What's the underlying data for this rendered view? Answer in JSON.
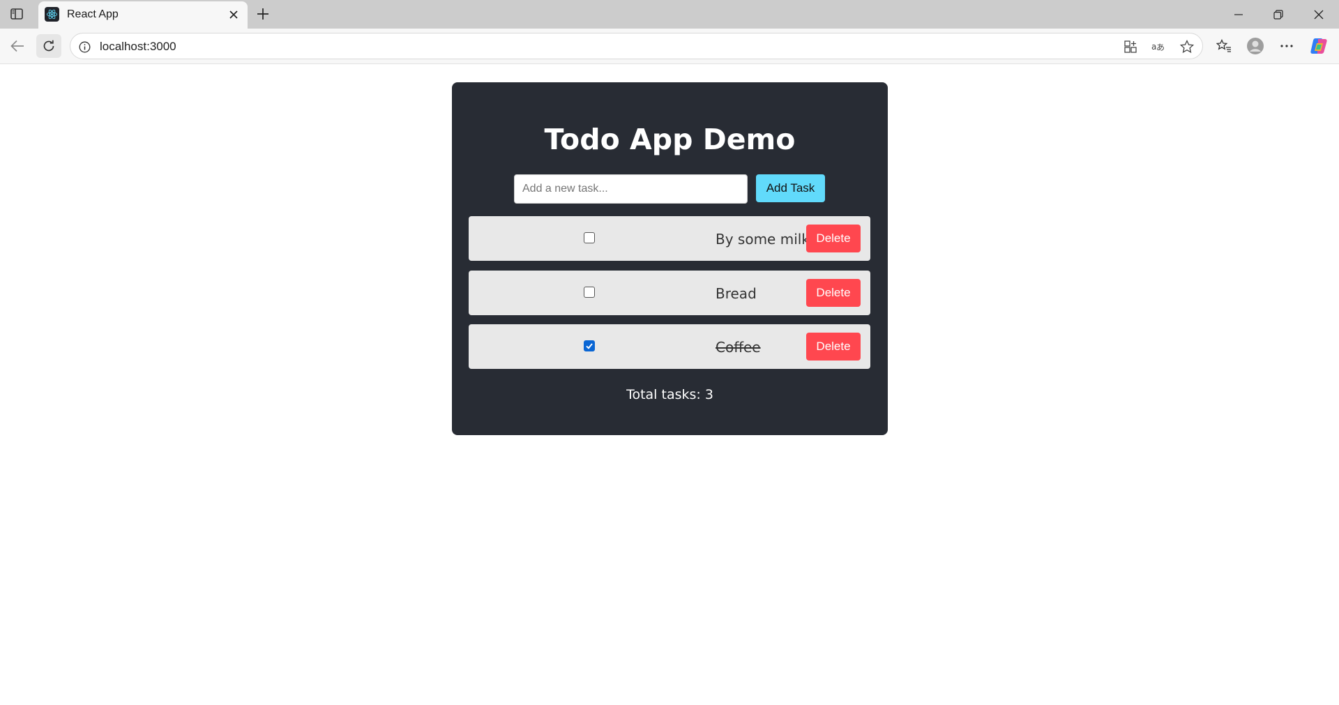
{
  "browser": {
    "tab_title": "React App",
    "url": "localhost:3000",
    "icons": {
      "sidebar": "sidebar-toggle-icon",
      "favicon": "react-logo-icon",
      "tab_close": "close-icon",
      "new_tab": "plus-icon",
      "back": "arrow-left-icon",
      "reload": "reload-icon",
      "site_info": "info-icon",
      "apps": "apps-icon",
      "translate": "translate-icon",
      "favorite": "star-icon",
      "favorites_list": "favorites-icon",
      "profile": "profile-icon",
      "more": "more-icon",
      "copilot": "copilot-icon"
    }
  },
  "app": {
    "title": "Todo App Demo",
    "input": {
      "placeholder": "Add a new task...",
      "value": ""
    },
    "add_button_label": "Add Task",
    "tasks": [
      {
        "text": "By some milk",
        "completed": false,
        "delete_label": "Delete"
      },
      {
        "text": "Bread",
        "completed": false,
        "delete_label": "Delete"
      },
      {
        "text": "Coffee",
        "completed": true,
        "delete_label": "Delete"
      }
    ],
    "total_text": "Total tasks: 3",
    "colors": {
      "card_background": "#282c34",
      "add_button": "#61dafb",
      "delete_button": "#ff474f",
      "task_row": "#e8e8e8"
    }
  }
}
